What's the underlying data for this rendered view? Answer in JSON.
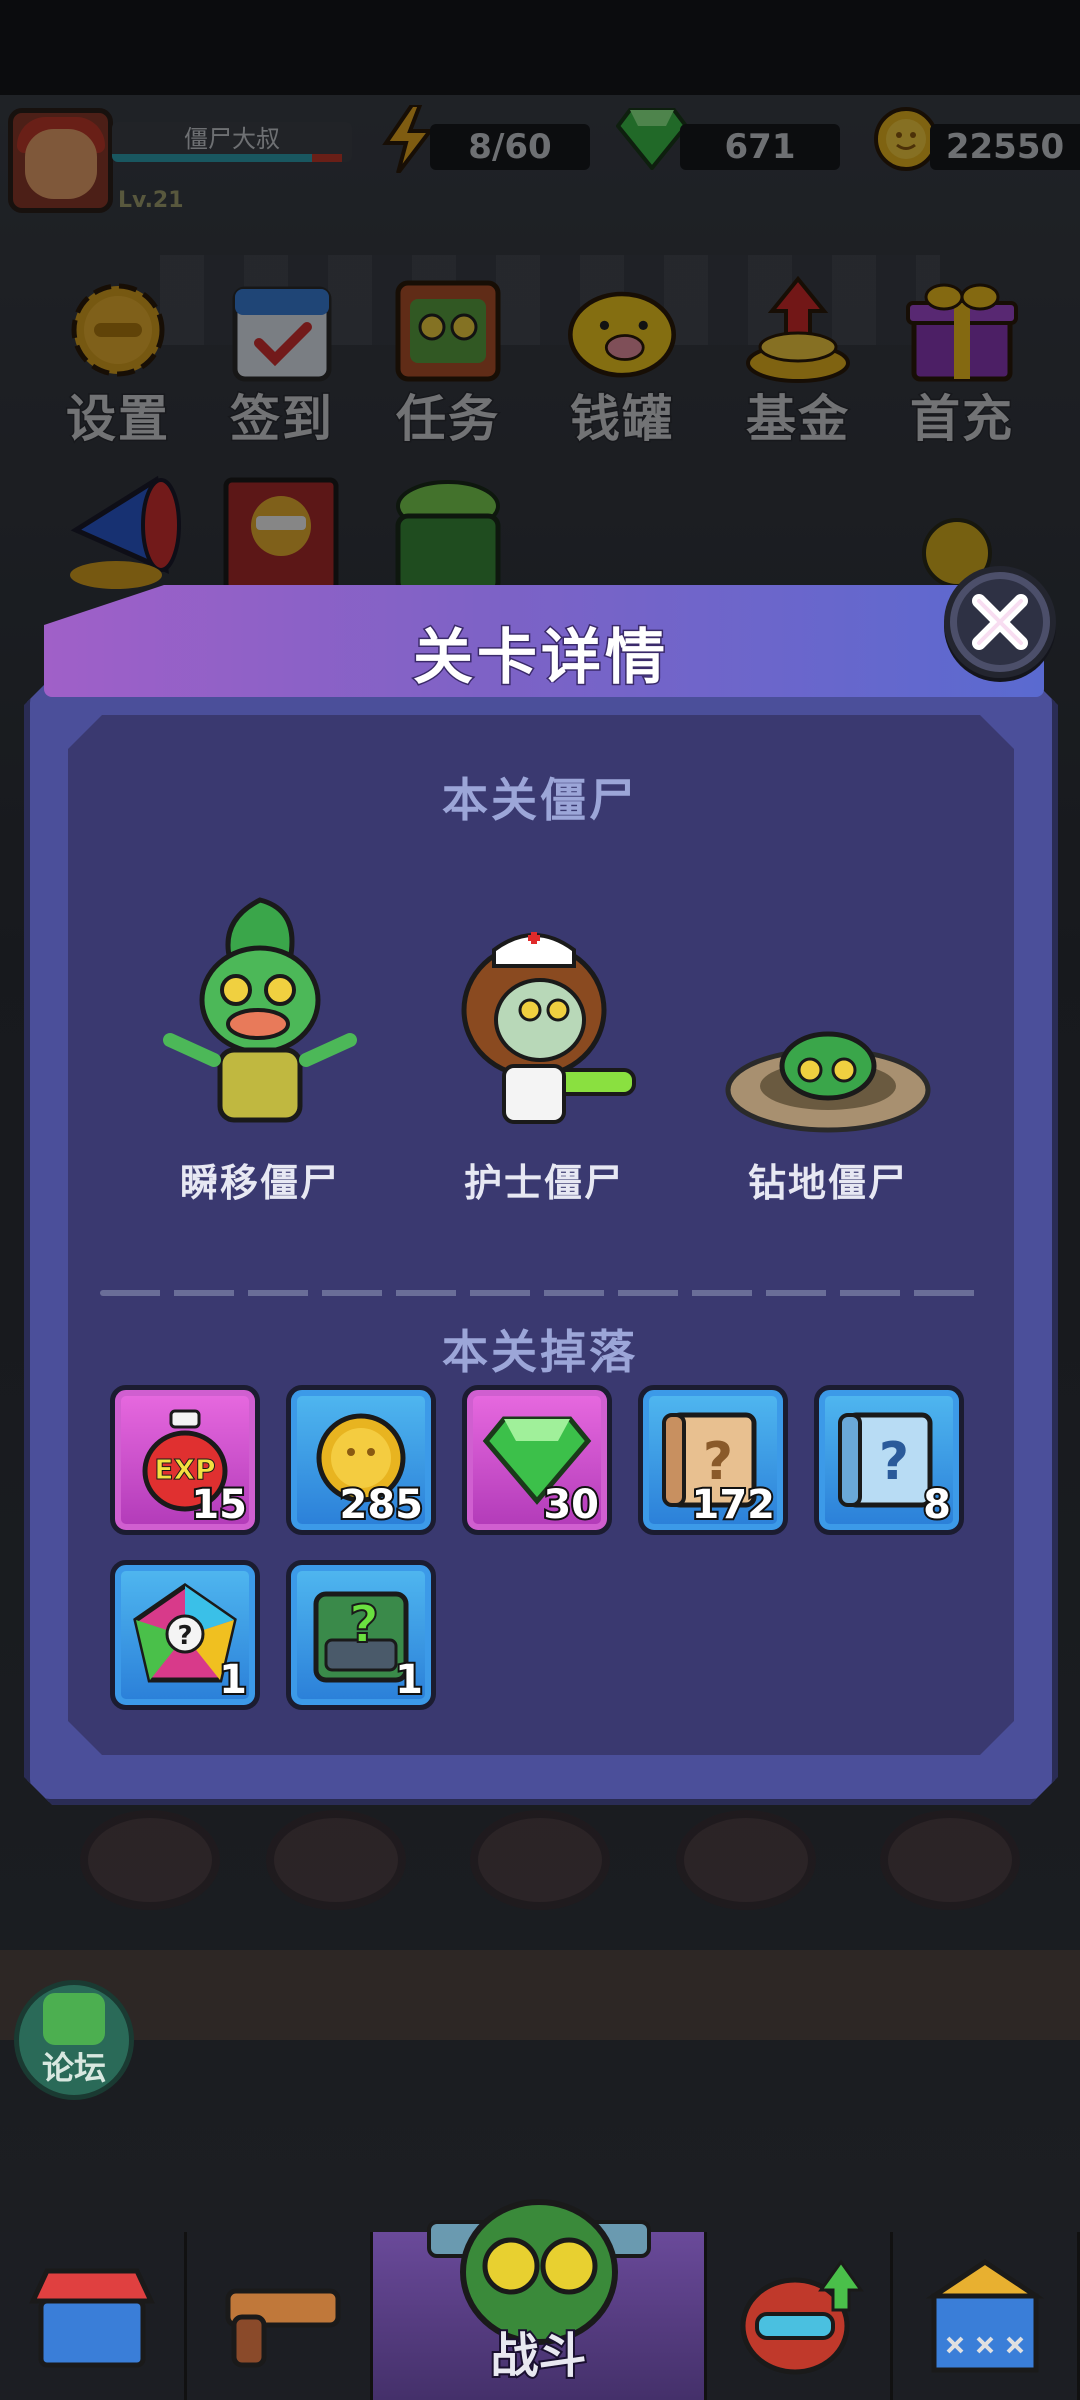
{
  "player": {
    "name": "僵尸大叔",
    "level": "Lv.21",
    "energy": "8/60",
    "gems": "671",
    "coins": "22550"
  },
  "menu": [
    {
      "label": "设置",
      "icon": "gear-icon"
    },
    {
      "label": "签到",
      "icon": "calendar-icon"
    },
    {
      "label": "任务",
      "icon": "task-board-icon"
    },
    {
      "label": "钱罐",
      "icon": "piggy-bank-icon"
    },
    {
      "label": "基金",
      "icon": "fund-coins-icon"
    },
    {
      "label": "首充",
      "icon": "gift-box-icon"
    }
  ],
  "dialog": {
    "title": "关卡详情",
    "zombies_title": "本关僵尸",
    "zombies": [
      {
        "name": "瞬移僵尸",
        "icon": "teleport-zombie-icon"
      },
      {
        "name": "护士僵尸",
        "icon": "nurse-zombie-icon"
      },
      {
        "name": "钻地僵尸",
        "icon": "digger-zombie-icon"
      }
    ],
    "drops_title": "本关掉落",
    "drops": [
      {
        "icon": "exp-potion-icon",
        "qty": "15",
        "frame": "pink"
      },
      {
        "icon": "gold-coin-icon",
        "qty": "285",
        "frame": "blue"
      },
      {
        "icon": "green-gem-icon",
        "qty": "30",
        "frame": "pink"
      },
      {
        "icon": "orange-mystery-scroll-icon",
        "qty": "172",
        "frame": "blue"
      },
      {
        "icon": "blue-mystery-scroll-icon",
        "qty": "8",
        "frame": "blue"
      },
      {
        "icon": "rainbow-mystery-chip-icon",
        "qty": "1",
        "frame": "blue"
      },
      {
        "icon": "mystery-gear-part-icon",
        "qty": "1",
        "frame": "blue"
      }
    ]
  },
  "forum": {
    "label": "论坛"
  },
  "nav": {
    "battle_label": "战斗"
  },
  "colors": {
    "dialog_body": "#4b4f9a",
    "dialog_inner": "#3a3970",
    "header_gradient_start": "#a060c8",
    "header_gradient_end": "#5a6ad0",
    "section_title": "#9ca6d8",
    "frame_pink": "#d05fd0",
    "frame_blue": "#3c9ae8"
  }
}
